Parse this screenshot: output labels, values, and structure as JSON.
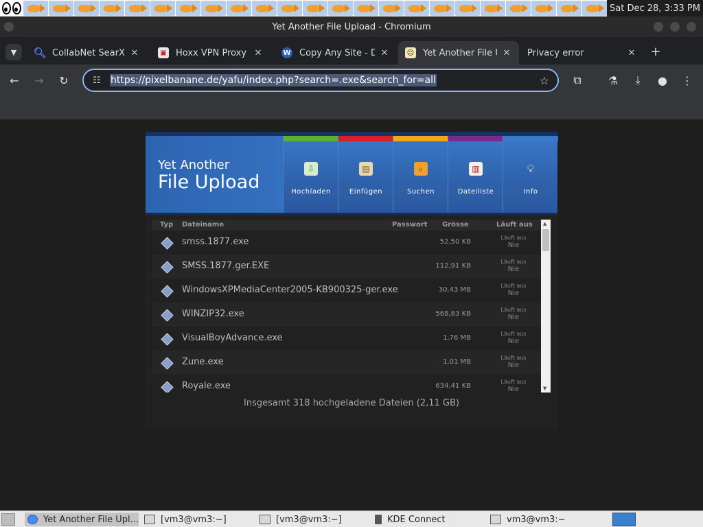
{
  "system": {
    "clock": "Sat Dec 28,  3:33 PM",
    "fish_count": 23
  },
  "window": {
    "title": "Yet Another File Upload - Chromium"
  },
  "tabs": [
    {
      "label": "CollabNet SearXNG",
      "icon": "search-icon",
      "active": false
    },
    {
      "label": "Hoxx VPN Proxy - Chrome Web Store",
      "icon": "hoxx-icon",
      "active": false
    },
    {
      "label": "Copy Any Site - Download",
      "icon": "w-icon",
      "active": false
    },
    {
      "label": "Yet Another File Upload",
      "icon": "yafu-icon",
      "active": true
    },
    {
      "label": "Privacy error",
      "icon": "",
      "active": false
    }
  ],
  "toolbar": {
    "url": "https://pixelbanane.de/yafu/index.php?search=.exe&search_for=all"
  },
  "site": {
    "logo_line1": "Yet Another",
    "logo_line2": "File Upload",
    "nav": [
      {
        "label": "Hochladen",
        "color": "#5cb030",
        "icon": "upload-icon"
      },
      {
        "label": "Einfügen",
        "color": "#d8202a",
        "icon": "clipboard-icon"
      },
      {
        "label": "Suchen",
        "color": "#f0a818",
        "icon": "search-folder-icon"
      },
      {
        "label": "Dateiliste",
        "color": "#7a2a88",
        "icon": "book-icon"
      },
      {
        "label": "Info",
        "color": "#3a78c8",
        "icon": "info-bulb-icon"
      }
    ]
  },
  "table": {
    "headers": {
      "type": "Typ",
      "name": "Dateiname",
      "password": "Passwort",
      "size": "Grösse",
      "expires": "Läuft aus"
    },
    "rows": [
      {
        "name": "smss.1877.exe",
        "size": "52,50 KB",
        "exp_label": "Läuft aus",
        "exp_value": "Nie"
      },
      {
        "name": "SMSS.1877.ger.EXE",
        "size": "112,91 KB",
        "exp_label": "Läuft aus",
        "exp_value": "Nie"
      },
      {
        "name": "WindowsXPMediaCenter2005-KB900325-ger.exe",
        "size": "30,43 MB",
        "exp_label": "Läuft aus",
        "exp_value": "Nie"
      },
      {
        "name": "WINZIP32.exe",
        "size": "568,83 KB",
        "exp_label": "Läuft aus",
        "exp_value": "Nie"
      },
      {
        "name": "VisualBoyAdvance.exe",
        "size": "1,76 MB",
        "exp_label": "Läuft aus",
        "exp_value": "Nie"
      },
      {
        "name": "Zune.exe",
        "size": "1,01 MB",
        "exp_label": "Läuft aus",
        "exp_value": "Nie"
      },
      {
        "name": "Royale.exe",
        "size": "634,41 KB",
        "exp_label": "Läuft aus",
        "exp_value": "Nie"
      }
    ],
    "total": "Insgesamt 318 hochgeladene Dateien (2,11 GB)"
  },
  "taskbar": {
    "items": [
      {
        "label": "Yet Another File Upl...",
        "active": true
      },
      {
        "label": "[vm3@vm3:~]",
        "active": false
      },
      {
        "label": "[vm3@vm3:~]",
        "active": false
      },
      {
        "label": "KDE Connect",
        "active": false
      },
      {
        "label": "vm3@vm3:~",
        "active": false
      }
    ]
  }
}
